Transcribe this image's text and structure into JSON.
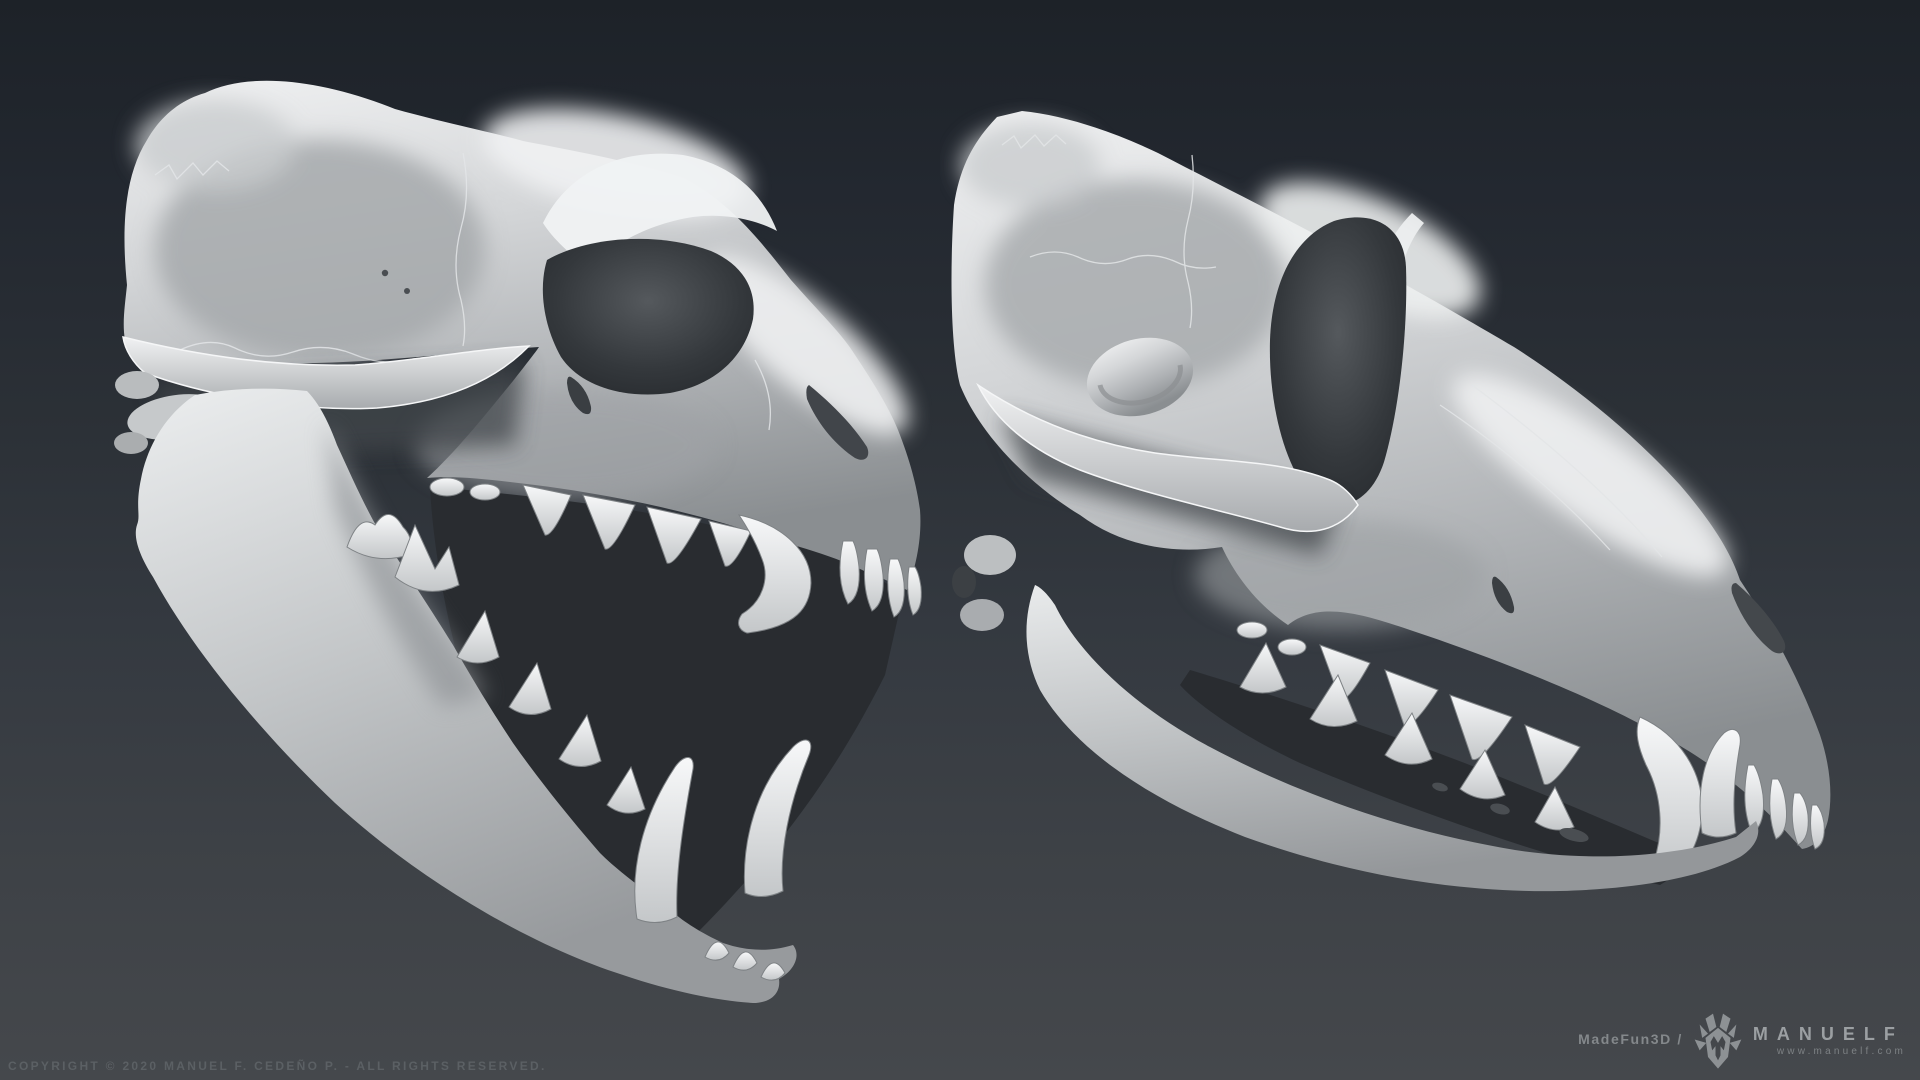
{
  "scene": {
    "description": "Two grayscale 3D sculpt renders of wolf skulls on a dark gradient background",
    "left_skull_alt": "Wolf skull three-quarter view with jaws wide open",
    "right_skull_alt": "Wolf skull three-quarter view with jaws closed",
    "background_top_color": "#1d2228",
    "background_bottom_color": "#45484c",
    "bone_color": "#d4d6d8"
  },
  "footer": {
    "copyright": "COPYRIGHT © 2020 MANUEL F. CEDEÑO P. - ALL RIGHTS RESERVED."
  },
  "credits": {
    "studio": "MadeFun3D /",
    "brand": "MANUELF",
    "website": "www.manuelf.com",
    "logo_icon": "deer-head-logo-icon",
    "text_color": "#8b8f92"
  }
}
